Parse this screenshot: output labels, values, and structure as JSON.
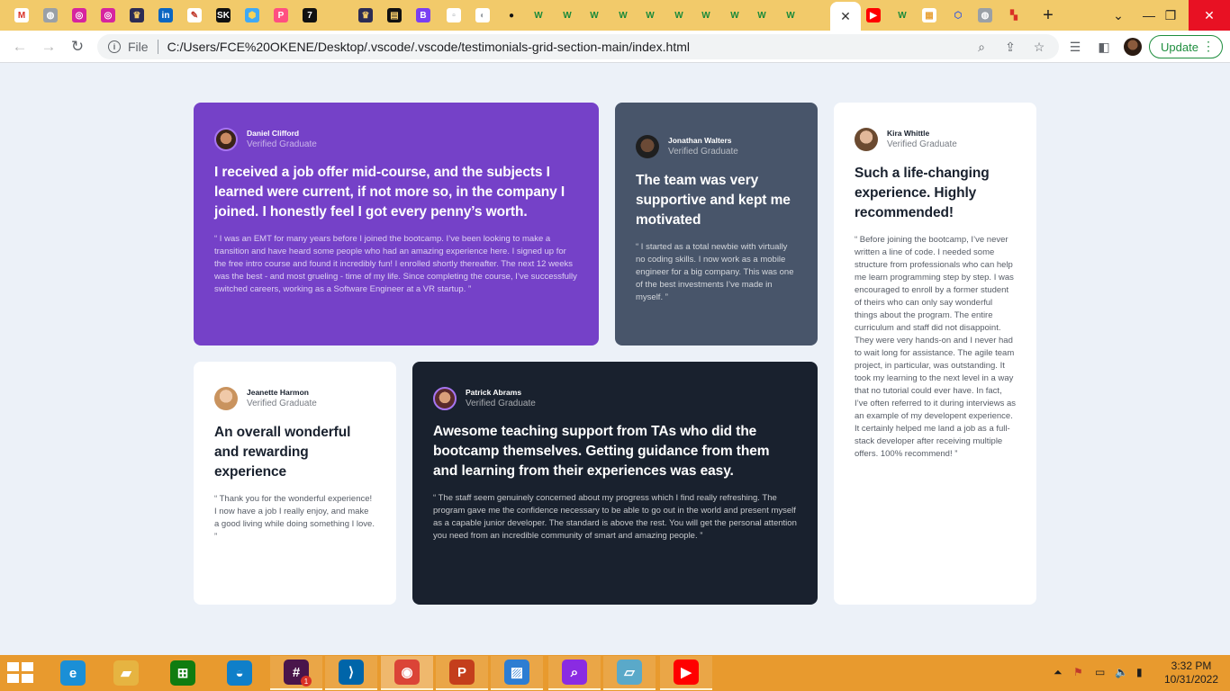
{
  "browser": {
    "tabs": [
      {
        "icon": "gmail-icon",
        "label": "M",
        "bg": "#ffffff",
        "fg": "#d93025"
      },
      {
        "icon": "globe-icon",
        "label": "◍",
        "bg": "#9aa0a6",
        "fg": "#ffffff"
      },
      {
        "icon": "instagram-icon",
        "label": "◎",
        "bg": "#d6249f",
        "fg": "#ffffff"
      },
      {
        "icon": "instagram-icon",
        "label": "◎",
        "bg": "#d6249f",
        "fg": "#ffffff"
      },
      {
        "icon": "crown-icon",
        "label": "♛",
        "bg": "#2c2c54",
        "fg": "#f2ca6a"
      },
      {
        "icon": "linkedin-icon",
        "label": "in",
        "bg": "#0a66c2",
        "fg": "#ffffff"
      },
      {
        "icon": "sketch-icon",
        "label": "✎",
        "bg": "#ffffff",
        "fg": "#c0392b"
      },
      {
        "icon": "sk-icon",
        "label": "SK",
        "bg": "#111111",
        "fg": "#ffffff"
      },
      {
        "icon": "hexagon-icon",
        "label": "⬢",
        "bg": "#3fa9f5",
        "fg": "#f7d358"
      },
      {
        "icon": "p-icon",
        "label": "P",
        "bg": "#ff4f81",
        "fg": "#ffffff"
      },
      {
        "icon": "seven-icon",
        "label": "7",
        "bg": "#111111",
        "fg": "#ffffff"
      },
      {
        "icon": "crown-icon",
        "label": "♛",
        "bg": "#2c2c54",
        "fg": "#f2ca6a"
      },
      {
        "icon": "chat-icon",
        "label": "▤",
        "bg": "#111111",
        "fg": "#f2ca6a"
      },
      {
        "icon": "b-icon",
        "label": "B",
        "bg": "#7a3ff2",
        "fg": "#ffffff"
      },
      {
        "icon": "doc-icon",
        "label": "▫",
        "bg": "#ffffff",
        "fg": "#9aa0a6"
      },
      {
        "icon": "refresh-circle-icon",
        "label": "◐",
        "bg": "#ffffff",
        "fg": "#9aa0a6"
      },
      {
        "icon": "github-icon",
        "label": "●",
        "bg": "#f2ca6a",
        "fg": "#111111"
      },
      {
        "icon": "w-icon",
        "label": "W",
        "bg": "#f2ca6a",
        "fg": "#1a8a3a"
      },
      {
        "icon": "w-icon",
        "label": "W",
        "bg": "#f2ca6a",
        "fg": "#1a8a3a"
      },
      {
        "icon": "w-icon",
        "label": "W",
        "bg": "#f2ca6a",
        "fg": "#1a8a3a"
      },
      {
        "icon": "w-icon",
        "label": "W",
        "bg": "#f2ca6a",
        "fg": "#1a8a3a"
      },
      {
        "icon": "w-icon",
        "label": "W",
        "bg": "#f2ca6a",
        "fg": "#1a8a3a"
      },
      {
        "icon": "w-icon",
        "label": "W",
        "bg": "#f2ca6a",
        "fg": "#1a8a3a"
      },
      {
        "icon": "w-icon",
        "label": "W",
        "bg": "#f2ca6a",
        "fg": "#1a8a3a"
      },
      {
        "icon": "w-icon",
        "label": "W",
        "bg": "#f2ca6a",
        "fg": "#1a8a3a"
      },
      {
        "icon": "w-icon",
        "label": "W",
        "bg": "#f2ca6a",
        "fg": "#1a8a3a"
      },
      {
        "icon": "w-icon",
        "label": "W",
        "bg": "#f2ca6a",
        "fg": "#1a8a3a"
      },
      {
        "icon": "youtube-icon",
        "label": "▶",
        "bg": "#ff0000",
        "fg": "#ffffff"
      },
      {
        "icon": "w-icon",
        "label": "W",
        "bg": "#f2ca6a",
        "fg": "#1a8a3a"
      },
      {
        "icon": "sheet-icon",
        "label": "▦",
        "bg": "#ffffff",
        "fg": "#e8a33a"
      },
      {
        "icon": "hexagon-outline-icon",
        "label": "⬡",
        "bg": "#f2ca6a",
        "fg": "#3b5bdb"
      },
      {
        "icon": "globe-icon",
        "label": "◍",
        "bg": "#9aa0a6",
        "fg": "#ffffff"
      },
      {
        "icon": "blocks-icon",
        "label": "▚",
        "bg": "#f2ca6a",
        "fg": "#d93025"
      }
    ],
    "active_tab_close": "✕",
    "new_tab": "+",
    "tab_search": "⌄",
    "window_controls": {
      "minimize": "—",
      "restore": "❐",
      "close": "✕"
    },
    "toolbar": {
      "back": "←",
      "forward": "→",
      "reload": "↻",
      "info": "i",
      "scheme_label": "File",
      "url": "C:/Users/FCE%20OKENE/Desktop/.vscode/.vscode/testimonials-grid-section-main/index.html",
      "zoom": "⌕",
      "share": "⇪",
      "bookmark": "☆",
      "reading_list": "☰",
      "side_panel": "◧",
      "update_label": "Update",
      "menu": "⋮"
    }
  },
  "testimonials": [
    {
      "name": "Daniel Clifford",
      "role": "Verified Graduate",
      "headline": "I received a job offer mid-course, and the subjects I learned were current, if not more so, in the company I joined. I honestly feel I got every penny’s worth.",
      "quote": "“ I was an EMT for many years before I joined the bootcamp. I’ve been looking to make a transition and have heard some people who had an amazing experience here. I signed up for the free intro course and found it incredibly fun! I enrolled shortly thereafter. The next 12 weeks was the best - and most grueling - time of my life. Since completing the course, I’ve successfully switched careers, working as a Software Engineer at a VR startup. ”",
      "bg": "#7541c8"
    },
    {
      "name": "Jonathan Walters",
      "role": "Verified Graduate",
      "headline": "The team was very supportive and kept me motivated",
      "quote": "“ I started as a total newbie with virtually no coding skills. I now work as a mobile engineer for a big company. This was one of the best investments I’ve made in myself. ”",
      "bg": "#48556a"
    },
    {
      "name": "Kira Whittle",
      "role": "Verified Graduate",
      "headline": "Such a life-changing experience. Highly recommended!",
      "quote": "“ Before joining the bootcamp, I’ve never written a line of code. I needed some structure from professionals who can help me learn programming step by step. I was encouraged to enroll by a former student of theirs who can only say wonderful things about the program. The entire curriculum and staff did not disappoint. They were very hands-on and I never had to wait long for assistance. The agile team project, in particular, was outstanding. It took my learning to the next level in a way that no tutorial could ever have. In fact, I’ve often referred to it during interviews as an example of my developent experience. It certainly helped me land a job as a full-stack developer after receiving multiple offers. 100% recommend! ”",
      "bg": "#ffffff"
    },
    {
      "name": "Jeanette Harmon",
      "role": "Verified Graduate",
      "headline": "An overall wonderful and rewarding experience",
      "quote": "“ Thank you for the wonderful experience! I now have a job I really enjoy, and make a good living while doing something I love. ”",
      "bg": "#ffffff"
    },
    {
      "name": "Patrick Abrams",
      "role": "Verified Graduate",
      "headline": "Awesome teaching support from TAs who did the bootcamp themselves. Getting guidance from them and learning from their experiences was easy.",
      "quote": "“ The staff seem genuinely concerned about my progress which I find really refreshing. The program gave me the confidence necessary to be able to go out in the world and present myself as a capable junior developer. The standard is above the rest. You will get the personal attention you need from an incredible community of smart and amazing people. ”",
      "bg": "#19212e"
    }
  ],
  "taskbar": {
    "apps": [
      {
        "icon": "internet-explorer-icon",
        "label": "e",
        "bg": "#1b8fd6"
      },
      {
        "icon": "file-explorer-icon",
        "label": "▰",
        "bg": "#e6b441"
      },
      {
        "icon": "store-icon",
        "label": "⊞",
        "bg": "#107c10"
      },
      {
        "icon": "edge-icon",
        "label": "◒",
        "bg": "#0f7fc9"
      },
      {
        "icon": "slack-icon",
        "label": "#",
        "bg": "#4a154b"
      },
      {
        "icon": "vscode-icon",
        "label": "⟩",
        "bg": "#0065a9"
      },
      {
        "icon": "chrome-icon",
        "label": "◉",
        "bg": "#db4437"
      },
      {
        "icon": "powerpoint-icon",
        "label": "P",
        "bg": "#c43e1c"
      },
      {
        "icon": "photos-icon",
        "label": "▨",
        "bg": "#2d7dd2"
      },
      {
        "icon": "search-app-icon",
        "label": "⌕",
        "bg": "#8a2be2"
      },
      {
        "icon": "notes-icon",
        "label": "▱",
        "bg": "#5aa9c9"
      },
      {
        "icon": "youtube-music-icon",
        "label": "▶",
        "bg": "#ff0000"
      }
    ],
    "slack_badge": "1",
    "tray": {
      "show_hidden": "⏶",
      "flag": "⚑",
      "battery": "▭",
      "volume": "🔈",
      "network": "▮"
    },
    "time": "3:32 PM",
    "date": "10/31/2022"
  }
}
